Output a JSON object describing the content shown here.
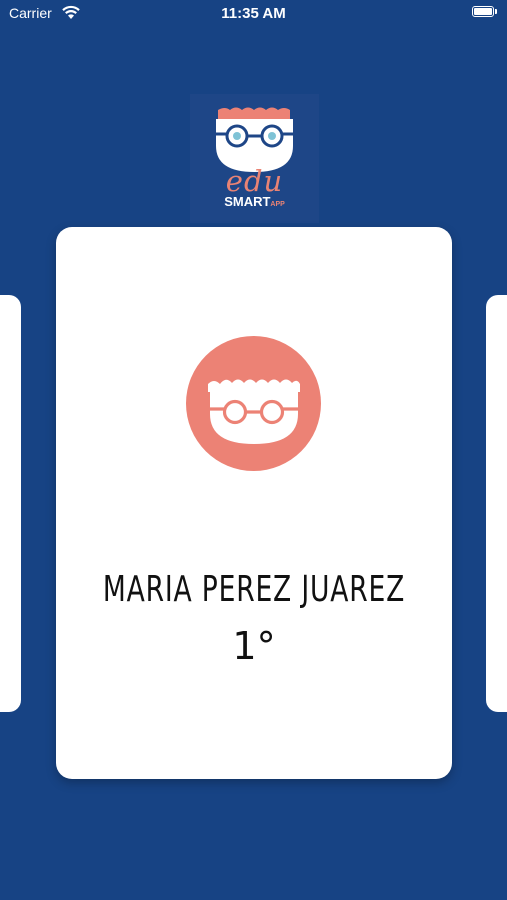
{
  "status_bar": {
    "carrier": "Carrier",
    "time": "11:35 AM"
  },
  "logo": {
    "title": "edu",
    "subtitle": "SMART",
    "subtitle_suffix": "APP"
  },
  "student": {
    "name": "MARIA PEREZ JUAREZ",
    "grade": "1°"
  },
  "colors": {
    "background": "#174384",
    "accent": "#EC8275",
    "card": "#FFFFFF"
  },
  "icons": [
    "wifi-icon",
    "battery-icon",
    "student-avatar-icon"
  ]
}
